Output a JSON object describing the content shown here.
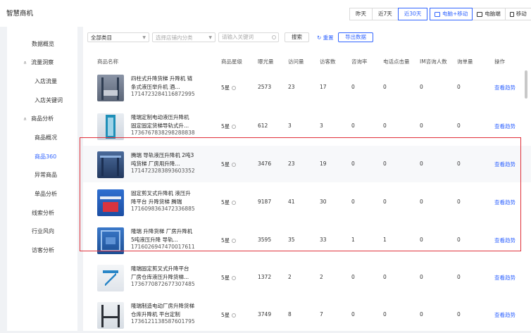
{
  "app": {
    "title": "智慧商机"
  },
  "date_range": {
    "options": [
      "昨天",
      "近7天",
      "近30天"
    ],
    "selected": "近30天"
  },
  "device": {
    "options": [
      "电脑+移动",
      "电脑端",
      "移动"
    ],
    "selected": "电脑+移动"
  },
  "sidebar": {
    "items": [
      {
        "label": "数据概览",
        "type": "item"
      },
      {
        "label": "流量洞察",
        "type": "group"
      },
      {
        "label": "入店流量",
        "type": "sub"
      },
      {
        "label": "入店关键词",
        "type": "sub"
      },
      {
        "label": "商品分析",
        "type": "group"
      },
      {
        "label": "商品概况",
        "type": "sub"
      },
      {
        "label": "商品360",
        "type": "sub",
        "active": true
      },
      {
        "label": "异常商品",
        "type": "sub"
      },
      {
        "label": "单品分析",
        "type": "sub"
      },
      {
        "label": "线索分析",
        "type": "item"
      },
      {
        "label": "行业风向",
        "type": "item"
      },
      {
        "label": "访客分析",
        "type": "item"
      }
    ]
  },
  "filters": {
    "category": {
      "value": "全部类目"
    },
    "store_category": {
      "placeholder": "选择店铺内分类"
    },
    "keyword": {
      "placeholder": "请输入关键词"
    },
    "search_label": "搜索",
    "reset_label": "重置",
    "export_label": "导出数据"
  },
  "table": {
    "columns": [
      "商品名称",
      "商品星级",
      "曝光量",
      "访问量",
      "访客数",
      "咨询率",
      "电话点击量",
      "IM咨询人数",
      "询单量",
      "操作"
    ],
    "action_label": "查看趋势",
    "rows": [
      {
        "name": "四柱式升降货梯 升降机 链条式液压举升机 酒...",
        "id": "1714723284116872995",
        "star": "5星",
        "exposure": "2573",
        "visits": "23",
        "visitors": "17",
        "consult_rate": "0",
        "phone_clicks": "0",
        "im_consults": "0",
        "inquiries": "0"
      },
      {
        "name": "隆瑞定制电动液压升降机 固定固定货梯导轨式升...",
        "id": "1736767838298288838",
        "star": "5星",
        "exposure": "612",
        "visits": "3",
        "visitors": "3",
        "consult_rate": "0",
        "phone_clicks": "0",
        "im_consults": "0",
        "inquiries": "0"
      },
      {
        "name": "腾瑞 导轨液压升降机 2吨3吨货梯 厂房用升降...",
        "id": "1714723283893603352",
        "star": "5星",
        "exposure": "3476",
        "visits": "23",
        "visitors": "19",
        "consult_rate": "0",
        "phone_clicks": "0",
        "im_consults": "0",
        "inquiries": "0"
      },
      {
        "name": "固定剪叉式升降机 液压升降平台 升降货梯 腾瑞",
        "id": "1716098363472336885",
        "star": "5星",
        "exposure": "9187",
        "visits": "41",
        "visitors": "30",
        "consult_rate": "0",
        "phone_clicks": "0",
        "im_consults": "0",
        "inquiries": "0"
      },
      {
        "name": "隆瑞 升降货梯 厂房升降机 5吨液压升降 导轨...",
        "id": "1716026947470017611",
        "star": "5星",
        "exposure": "3595",
        "visits": "35",
        "visitors": "33",
        "consult_rate": "1",
        "phone_clicks": "1",
        "im_consults": "0",
        "inquiries": "0"
      },
      {
        "name": "隆瑞固定剪叉式升降平台 厂房仓库液压升降货梯...",
        "id": "1736770872677307485",
        "star": "5星",
        "exposure": "1372",
        "visits": "2",
        "visitors": "2",
        "consult_rate": "0",
        "phone_clicks": "0",
        "im_consults": "0",
        "inquiries": "0"
      },
      {
        "name": "隆瑞制造电动厂房升降货梯仓库升降机 平台定制",
        "id": "1736121138587601795",
        "star": "5星",
        "exposure": "3749",
        "visits": "8",
        "visitors": "7",
        "consult_rate": "0",
        "phone_clicks": "0",
        "im_consults": "0",
        "inquiries": "0"
      }
    ]
  },
  "colors": {
    "accent": "#3366ff",
    "highlight": "#e0303a"
  }
}
